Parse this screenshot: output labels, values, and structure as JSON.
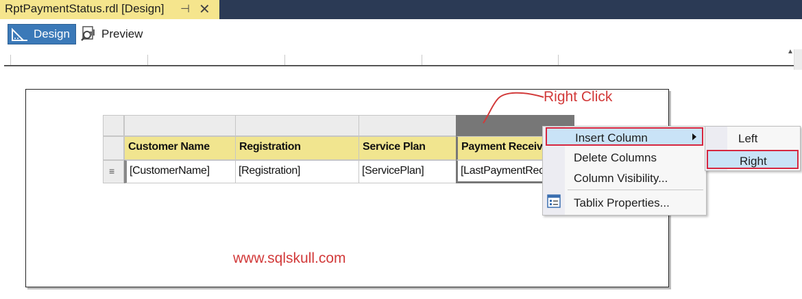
{
  "tab": {
    "title": "RptPaymentStatus.rdl [Design]",
    "pin_glyph": "⊣",
    "close_glyph": "✕"
  },
  "toolbar": {
    "design_label": "Design",
    "preview_label": "Preview"
  },
  "tablix": {
    "headers": [
      "Customer Name",
      "Registration",
      "Service Plan",
      "Payment Received"
    ],
    "cells": [
      "[CustomerName]",
      "[Registration]",
      "[ServicePlan]",
      "[LastPaymentRece"
    ]
  },
  "annotation": {
    "text": "Right Click",
    "watermark": "www.sqlskull.com"
  },
  "context_menu": {
    "items": [
      {
        "label": "Insert Column",
        "highlighted": true,
        "submenu": true
      },
      {
        "label": "Delete Columns"
      },
      {
        "label": "Column Visibility..."
      },
      {
        "label": "Tablix Properties...",
        "icon": "tablix-properties-icon"
      }
    ]
  },
  "submenu": {
    "items": [
      {
        "label": "Left"
      },
      {
        "label": "Right",
        "highlighted": true
      }
    ]
  },
  "colors": {
    "accent_red": "#d23a3a",
    "header_fill": "#f1e58f",
    "tab_active": "#f5e58d",
    "highlight": "#c9e3f7"
  }
}
